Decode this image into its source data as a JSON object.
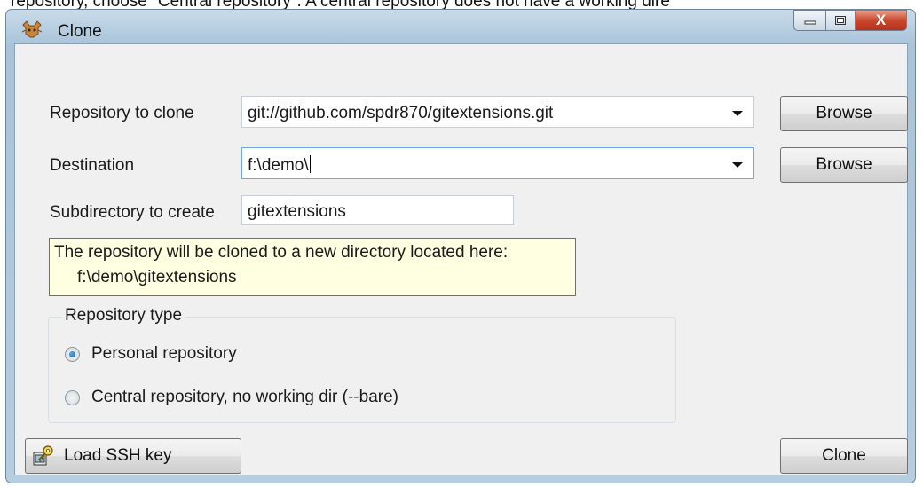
{
  "background_text": "repository, choose \"Central repository\". A central repository does not have a working dire",
  "window": {
    "title": "Clone",
    "close_glyph": "X"
  },
  "form": {
    "repo_label": "Repository to clone",
    "repo_value": "git://github.com/spdr870/gitextensions.git",
    "destination_label": "Destination",
    "destination_value": "f:\\demo\\",
    "subdir_label": "Subdirectory to create",
    "subdir_value": "gitextensions",
    "browse_label": "Browse"
  },
  "info": {
    "line1": "The repository will be cloned to a new directory located here:",
    "line2": "f:\\demo\\gitextensions"
  },
  "repo_type": {
    "title": "Repository type",
    "options": [
      {
        "label": "Personal repository",
        "checked": true
      },
      {
        "label": "Central repository, no working dir  (--bare)",
        "checked": false
      }
    ]
  },
  "buttons": {
    "load_ssh_key": "Load SSH key",
    "clone": "Clone"
  },
  "colors": {
    "info_bg": "#ffffe1",
    "radio_selected": "#1a5ea6",
    "close_button": "#c9462c"
  }
}
